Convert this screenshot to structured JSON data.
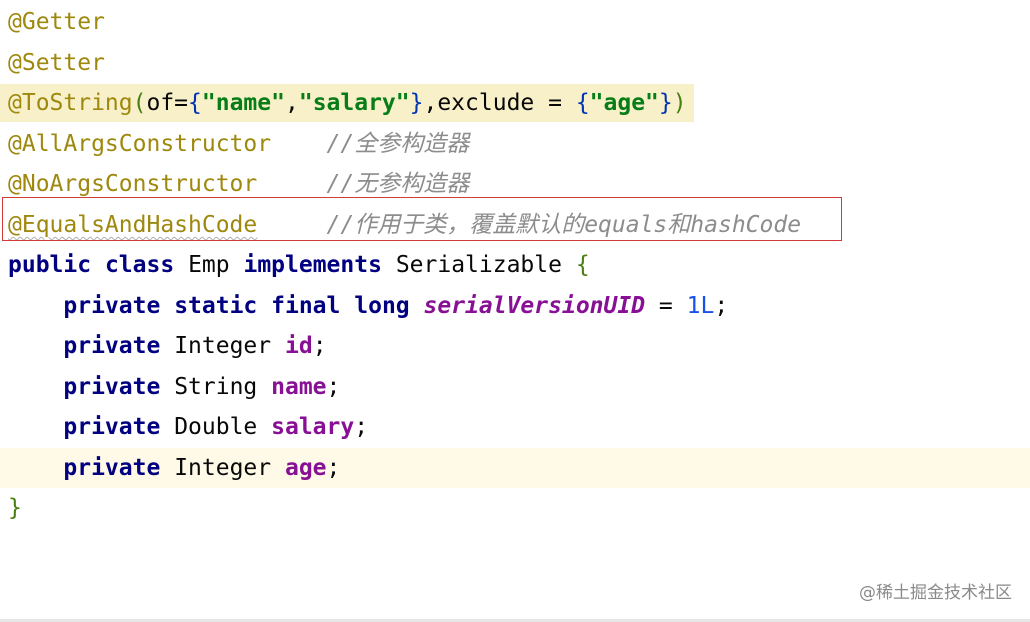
{
  "code": {
    "line1": {
      "annotation": "@Getter"
    },
    "line2": {
      "annotation": "@Setter"
    },
    "line3": {
      "annotation": "@ToString",
      "open_paren": "(",
      "of_key": "of=",
      "open_brace": "{",
      "str_name": "\"name\"",
      "comma1": ",",
      "str_salary": "\"salary\"",
      "close_brace": "}",
      "exclude_key": ",exclude = ",
      "open_brace2": "{",
      "str_age": "\"age\"",
      "close_brace2": "}",
      "close_paren": ")"
    },
    "line4": {
      "annotation": "@AllArgsConstructor",
      "comment": "//全参构造器"
    },
    "line5": {
      "annotation": "@NoArgsConstructor",
      "comment": "//无参构造器"
    },
    "line6": {
      "annotation": "@EqualsAndHashCode",
      "comment": "//作用于类，覆盖默认的equals和hashCode"
    },
    "line7": {
      "kw_public": "public",
      "kw_class": "class",
      "class_name": "Emp",
      "kw_implements": "implements",
      "iface": "Serializable",
      "open_brace": "{"
    },
    "line8": {
      "kw_private": "private",
      "kw_static": "static",
      "kw_final": "final",
      "kw_long": "long",
      "field": "serialVersionUID",
      "assign": " = ",
      "value": "1L",
      "semi": ";"
    },
    "line9": {
      "kw_private": "private",
      "type": "Integer",
      "field": "id",
      "semi": ";"
    },
    "line10": {
      "kw_private": "private",
      "type": "String",
      "field": "name",
      "semi": ";"
    },
    "line11": {
      "kw_private": "private",
      "type": "Double",
      "field": "salary",
      "semi": ";"
    },
    "line12": {
      "kw_private": "private",
      "type": "Integer",
      "field": "age",
      "semi": ";"
    },
    "line13": {
      "close_brace": "}"
    }
  },
  "watermark": {
    "text": "@稀土掘金技术社区"
  },
  "colors": {
    "annotation": "#9e880d",
    "keyword": "#0033b3",
    "string": "#067d17",
    "comment": "#8c8c8c",
    "field": "#871094",
    "number": "#1750eb",
    "highlight_box": "#d33a3a"
  }
}
